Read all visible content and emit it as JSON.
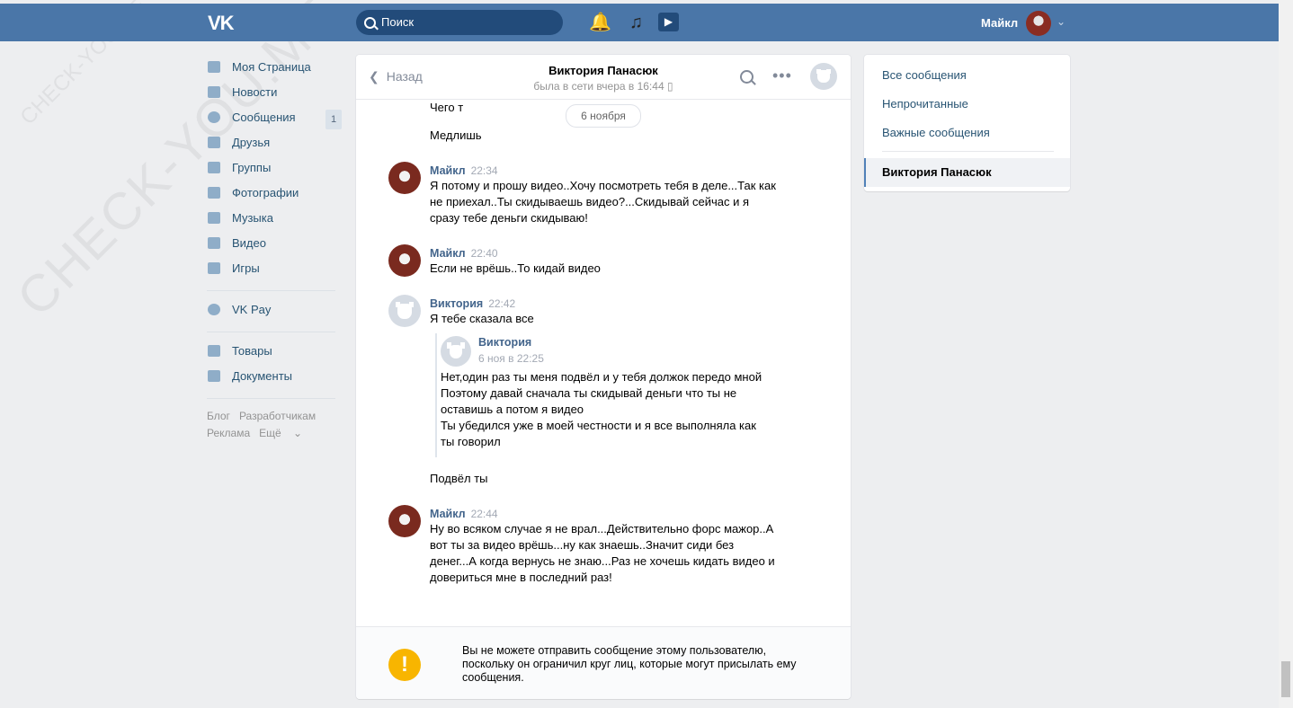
{
  "watermark": {
    "text_large": "CHECK-YOU.ME",
    "text_small": "CHECK-YOU.ME"
  },
  "header": {
    "logo": "VK",
    "search_placeholder": "Поиск",
    "user_name": "Майкл"
  },
  "sidebar": {
    "items": [
      {
        "label": "Моя Страница",
        "icon": "home-icon"
      },
      {
        "label": "Новости",
        "icon": "news-icon"
      },
      {
        "label": "Сообщения",
        "icon": "messages-icon",
        "badge": "1"
      },
      {
        "label": "Друзья",
        "icon": "friends-icon"
      },
      {
        "label": "Группы",
        "icon": "groups-icon"
      },
      {
        "label": "Фотографии",
        "icon": "photo-icon"
      },
      {
        "label": "Музыка",
        "icon": "music-icon"
      },
      {
        "label": "Видео",
        "icon": "video-icon"
      },
      {
        "label": "Игры",
        "icon": "games-icon"
      }
    ],
    "pay": {
      "label": "VK Pay",
      "icon": "vkpay-icon"
    },
    "extra": [
      {
        "label": "Товары",
        "icon": "goods-icon"
      },
      {
        "label": "Документы",
        "icon": "documents-icon"
      }
    ],
    "footer": {
      "blog": "Блог",
      "dev": "Разработчикам",
      "ads": "Реклама",
      "more": "Ещё"
    }
  },
  "chat": {
    "back_label": "Назад",
    "title": "Виктория Панасюк",
    "status": "была в сети вчера в 16:44",
    "date_divider": "6 ноября",
    "lines": {
      "l1": "Чего т",
      "l2": "Медлишь",
      "l3": "Подвёл ты"
    },
    "messages": [
      {
        "author": "Майкл",
        "time": "22:34",
        "text": "Я потому и прошу видео..Хочу посмотреть тебя в деле...Так как не приехал..Ты скидываешь видео?...Скидывай сейчас и я сразу тебе деньги скидываю!"
      },
      {
        "author": "Майкл",
        "time": "22:40",
        "text": "Если не врёшь..То кидай видео"
      },
      {
        "author": "Виктория",
        "time": "22:42",
        "text": "Я тебе сказала все"
      },
      {
        "author": "Майкл",
        "time": "22:44",
        "text": "Ну во всяком случае я не врал...Действительно форс мажор..А вот ты за видео врёшь...ну как знаешь..Значит сиди без денег...А когда вернусь не знаю...Раз не хочешь кидать видео и довериться мне в последний раз!"
      }
    ],
    "forwarded": {
      "author": "Виктория",
      "time": "6 ноя в 22:25",
      "text": "Нет,один раз ты меня подвёл и у тебя должок передо мной\nПоэтому давай сначала ты скидывай деньги что ты не оставишь а потом я видео\nТы убедился уже в моей честности и я все выполняла как ты говорил"
    },
    "notice": "Вы не можете отправить сообщение этому пользователю, поскольку он ограничил круг лиц, которые могут присылать ему сообщения."
  },
  "right_panel": {
    "items": [
      "Все сообщения",
      "Непрочитанные",
      "Важные сообщения"
    ],
    "active": "Виктория Панасюк"
  },
  "colors": {
    "header": "#4a76a8",
    "link": "#285473",
    "author": "#42648b",
    "warning": "#f8b500"
  }
}
